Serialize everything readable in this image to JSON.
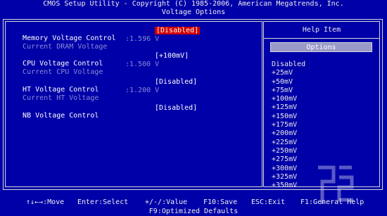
{
  "header": {
    "line1": "CMOS Setup Utility - Copyright (C) 1985-2006, American Megatrends, Inc.",
    "line2": "Voltage Options"
  },
  "settings": [
    {
      "label": "Memory Voltage Control",
      "value": "[Disabled]",
      "selected": true
    },
    {
      "label": "Current DRAM Voltage",
      "value": ":1.596 V",
      "readonly": true
    },
    {
      "label": "CPU Voltage Control",
      "value": "[+100mV]"
    },
    {
      "label": "Current CPU Voltage",
      "value": ":1.500 V",
      "readonly": true
    },
    {
      "label": "HT Voltage Control",
      "value": "[Disabled]"
    },
    {
      "label": "Current HT Voltage",
      "value": ":1.200 V",
      "readonly": true
    },
    {
      "label": "NB Voltage Control",
      "value": "[Disabled]"
    }
  ],
  "help": {
    "title": "Help Item",
    "options_header": "Options",
    "options": [
      "Disabled",
      "+25mV",
      "+50mV",
      "+75mV",
      "+100mV",
      "+125mV",
      "+150mV",
      "+175mV",
      "+200mV",
      "+225mV",
      "+250mV",
      "+275mV",
      "+300mV",
      "+325mV",
      "+350mV"
    ]
  },
  "footer": {
    "move": "↑↓←→:Move",
    "enter": "Enter:Select",
    "value": "+/-/:Value",
    "save": "F10:Save",
    "exit": "ESC:Exit",
    "help": "F1:General Help",
    "defaults": "F9:Optimized Defaults"
  },
  "colors": {
    "background": "#0000a8",
    "highlight": "#d00000",
    "options_header": "#9a9ac8",
    "disabled_text": "#8a8ad8"
  }
}
